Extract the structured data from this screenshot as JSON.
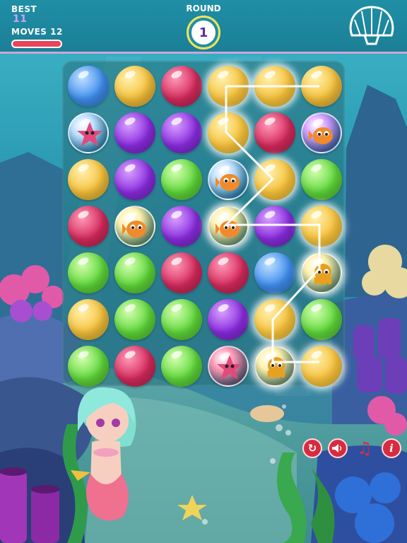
{
  "header": {
    "best_label": "BEST",
    "best_value": "11",
    "moves_label": "MOVES 12",
    "moves_progress": 1.0,
    "round_label": "ROUND",
    "round_value": "1"
  },
  "colors": {
    "blue": "#3f8ff0",
    "yellow": "#f6c13a",
    "red": "#d62a5c",
    "purple": "#8a2ce0",
    "green": "#5fd83a",
    "moves_bar": "#e8445a",
    "round_ring": "#f3e35a"
  },
  "board": {
    "rows": [
      [
        "blue",
        "yellow",
        "red",
        "yellow*",
        "yellow*",
        "yellow"
      ],
      [
        "blue:starfish",
        "purple",
        "purple",
        "yellow*",
        "red",
        "purple:fish"
      ],
      [
        "yellow",
        "purple",
        "green",
        "blue:fish",
        "yellow*",
        "green"
      ],
      [
        "red",
        "yellow:fish",
        "purple",
        "yellow:fish*",
        "purple",
        "yellow*"
      ],
      [
        "green",
        "green",
        "red",
        "red",
        "blue",
        "yellow:octopus*"
      ],
      [
        "yellow",
        "green",
        "green",
        "purple",
        "yellow*",
        "green"
      ],
      [
        "green",
        "red",
        "green",
        "red:starfish",
        "yellow:octopus*",
        "yellow*"
      ]
    ]
  },
  "controls": {
    "restart_icon": "restart-icon",
    "sound_icon": "speaker-icon",
    "music_icon": "music-note-icon",
    "info_icon": "info-icon"
  }
}
